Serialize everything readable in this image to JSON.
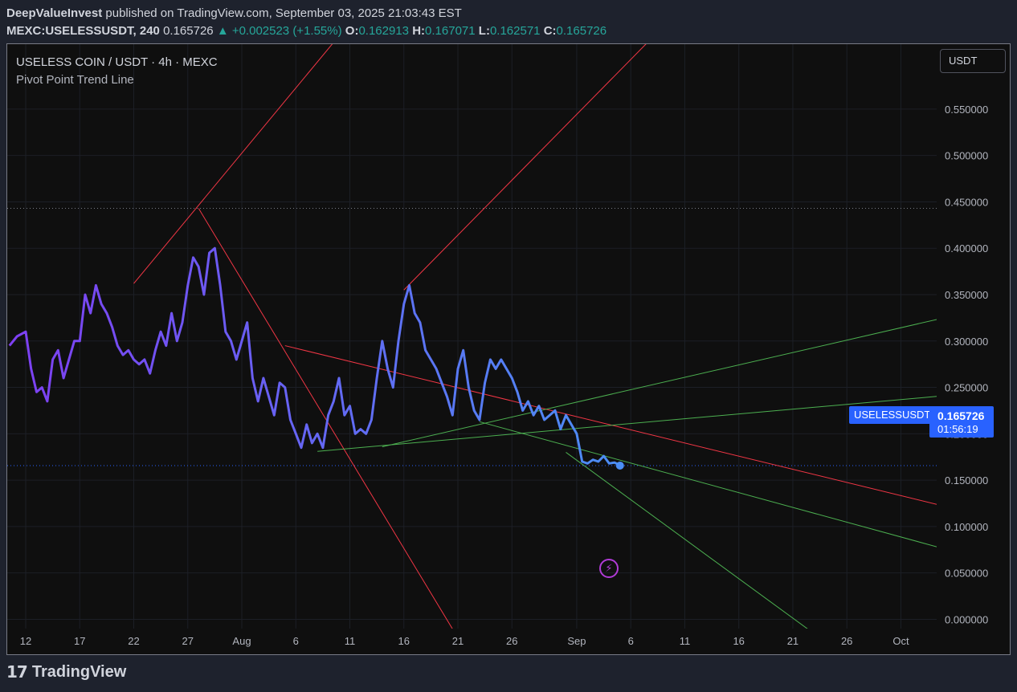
{
  "header": {
    "publisher": "DeepValueInvest",
    "published_text": "published on TradingView.com, September 03, 2025 21:03:43 EST",
    "symbol_interval": "MEXC:USELESSUSDT, 240",
    "last": "0.165726",
    "change": "▲ +0.002523 (+1.55%)",
    "o_label": "O:",
    "o": "0.162913",
    "h_label": "H:",
    "h": "0.167071",
    "l_label": "L:",
    "l": "0.162571",
    "c_label": "C:",
    "c": "0.165726"
  },
  "legend": {
    "title": "USELESS COIN / USDT · 4h · MEXC",
    "indicator": "Pivot Point Trend Line"
  },
  "currency_button": "USDT",
  "price_tag": {
    "symbol": "USELESSUSDT",
    "price": "0.165726",
    "countdown": "01:56:19"
  },
  "footer": {
    "brand": "TradingView"
  },
  "icons": {
    "bolt": "lightning-icon",
    "logo": "tradingview-logo-icon"
  },
  "chart_data": {
    "type": "line",
    "y_ticks": [
      "0.550000",
      "0.500000",
      "0.450000",
      "0.400000",
      "0.350000",
      "0.300000",
      "0.250000",
      "0.200000",
      "0.150000",
      "0.100000",
      "0.050000",
      "0.000000"
    ],
    "y_tick_values": [
      0.55,
      0.5,
      0.45,
      0.4,
      0.35,
      0.3,
      0.25,
      0.2,
      0.15,
      0.1,
      0.05,
      0.0
    ],
    "x_ticks": [
      "12",
      "17",
      "22",
      "27",
      "Aug",
      "6",
      "11",
      "16",
      "21",
      "26",
      "Sep",
      "6",
      "11",
      "16",
      "21",
      "26",
      "Oct"
    ],
    "x_tick_days": [
      0,
      5,
      10,
      15,
      20,
      25,
      30,
      35,
      40,
      45,
      51,
      56,
      61,
      66,
      71,
      76,
      81
    ],
    "x_start_label": "Jul 12",
    "ylim": [
      -0.01,
      0.62
    ],
    "series": [
      {
        "x": [
          -1.5,
          -0.8,
          0,
          0.5,
          1,
          1.5,
          2,
          2.5,
          3,
          3.5,
          4,
          4.5,
          5,
          5.5,
          6,
          6.5,
          7,
          7.5,
          8,
          8.5,
          9,
          9.5,
          10,
          10.5,
          11,
          11.5,
          12,
          12.5,
          13,
          13.5,
          14,
          14.5,
          15,
          15.5,
          16,
          16.5,
          17,
          17.5,
          18,
          18.5,
          19,
          19.5,
          20,
          20.5,
          21,
          21.5,
          22,
          22.5,
          23,
          23.5,
          24,
          24.5,
          25,
          25.5,
          26,
          26.5,
          27,
          27.5,
          28,
          28.5,
          29,
          29.5,
          30,
          30.5,
          31,
          31.5,
          32,
          32.5,
          33,
          33.5,
          34,
          34.5,
          35,
          35.5,
          36,
          36.5,
          37,
          37.5,
          38,
          38.5,
          39,
          39.5,
          40,
          40.5,
          41,
          41.5,
          42,
          42.5,
          43,
          43.5,
          44,
          44.5,
          45,
          45.5,
          46,
          46.5,
          47,
          47.5,
          48,
          48.5,
          49,
          49.5,
          50,
          50.5,
          51,
          51.5,
          52,
          52.5,
          53,
          53.5,
          54,
          54.5,
          55
        ],
        "values": [
          0.295,
          0.305,
          0.31,
          0.27,
          0.245,
          0.25,
          0.235,
          0.28,
          0.29,
          0.26,
          0.28,
          0.3,
          0.3,
          0.35,
          0.33,
          0.36,
          0.34,
          0.33,
          0.315,
          0.295,
          0.285,
          0.29,
          0.28,
          0.275,
          0.28,
          0.265,
          0.29,
          0.31,
          0.295,
          0.33,
          0.3,
          0.32,
          0.36,
          0.39,
          0.38,
          0.35,
          0.395,
          0.4,
          0.36,
          0.31,
          0.3,
          0.28,
          0.3,
          0.32,
          0.26,
          0.235,
          0.26,
          0.24,
          0.22,
          0.255,
          0.25,
          0.215,
          0.2,
          0.185,
          0.21,
          0.19,
          0.2,
          0.185,
          0.22,
          0.235,
          0.26,
          0.22,
          0.23,
          0.2,
          0.205,
          0.2,
          0.215,
          0.26,
          0.3,
          0.27,
          0.25,
          0.3,
          0.34,
          0.36,
          0.33,
          0.32,
          0.29,
          0.28,
          0.27,
          0.255,
          0.24,
          0.22,
          0.27,
          0.29,
          0.25,
          0.225,
          0.215,
          0.255,
          0.28,
          0.27,
          0.28,
          0.27,
          0.26,
          0.245,
          0.225,
          0.235,
          0.22,
          0.23,
          0.215,
          0.22,
          0.225,
          0.205,
          0.22,
          0.21,
          0.2,
          0.17,
          0.168,
          0.172,
          0.17,
          0.176,
          0.168,
          0.169,
          0.166
        ],
        "color_start": "#7e3ff2",
        "color_end": "#4b8ef5"
      }
    ],
    "horizontal_lines": [
      {
        "value": 0.443,
        "color": "#787b86"
      },
      {
        "value": 0.165726,
        "color": "#2962ff"
      }
    ],
    "trend_lines": [
      {
        "color": "#f23645",
        "points": [
          [
            16,
            0.443
          ],
          [
            40,
            -0.02
          ]
        ]
      },
      {
        "color": "#f23645",
        "points": [
          [
            10,
            0.362
          ],
          [
            30,
            0.643
          ]
        ]
      },
      {
        "color": "#f23645",
        "points": [
          [
            35,
            0.355
          ],
          [
            65,
            0.71
          ]
        ]
      },
      {
        "color": "#f23645",
        "points": [
          [
            24,
            0.295
          ],
          [
            85,
            0.122
          ]
        ]
      },
      {
        "color": "#4caf50",
        "points": [
          [
            27,
            0.181
          ],
          [
            85,
            0.241
          ]
        ]
      },
      {
        "color": "#4caf50",
        "points": [
          [
            33,
            0.186
          ],
          [
            85,
            0.325
          ]
        ]
      },
      {
        "color": "#4caf50",
        "points": [
          [
            42,
            0.213
          ],
          [
            85,
            0.076
          ]
        ]
      },
      {
        "color": "#4caf50",
        "points": [
          [
            50,
            0.18
          ],
          [
            73.5,
            -0.02
          ]
        ]
      }
    ],
    "last_point": {
      "x": 55,
      "value": 0.165726
    },
    "grid": true
  }
}
